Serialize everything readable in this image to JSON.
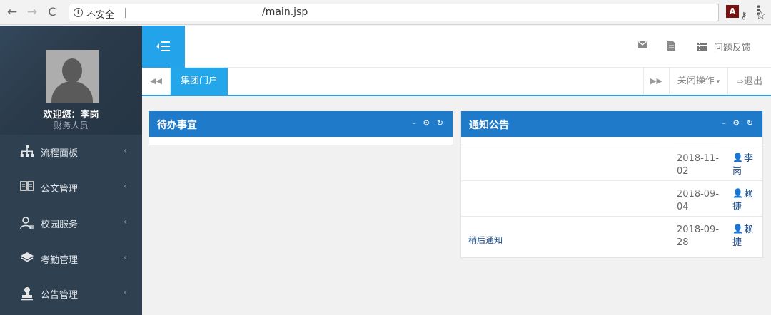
{
  "browser": {
    "security_label": "不安全",
    "url": "/main.jsp"
  },
  "sidebar": {
    "welcome": "欢迎您：李岗",
    "role": "财务人员",
    "items": [
      {
        "label": "流程面板",
        "icon": "sitemap-icon"
      },
      {
        "label": "公文管理",
        "icon": "book-icon"
      },
      {
        "label": "校园服务",
        "icon": "user-service-icon"
      },
      {
        "label": "考勤管理",
        "icon": "layers-icon"
      },
      {
        "label": "公告管理",
        "icon": "stamp-icon"
      }
    ]
  },
  "header": {
    "feedback_label": "问题反馈"
  },
  "tabs": {
    "active_label": "集团门户",
    "close_ops_label": "关闭操作",
    "logout_label": "退出"
  },
  "panels": {
    "todo_title": "待办事宜",
    "notice_title": "通知公告",
    "notices": [
      {
        "title": "",
        "date": "2018-11-\n02",
        "user": "李岗"
      },
      {
        "title": "",
        "date": "2018-09-\n04",
        "user": "赖捷"
      },
      {
        "title": "稍后通知",
        "date": "2018-09-\n28",
        "user": "赖捷"
      }
    ]
  },
  "colors": {
    "sidebar_bg": "#2f4050",
    "accent": "#24a6eb",
    "panel_head": "#1f7ac9"
  }
}
